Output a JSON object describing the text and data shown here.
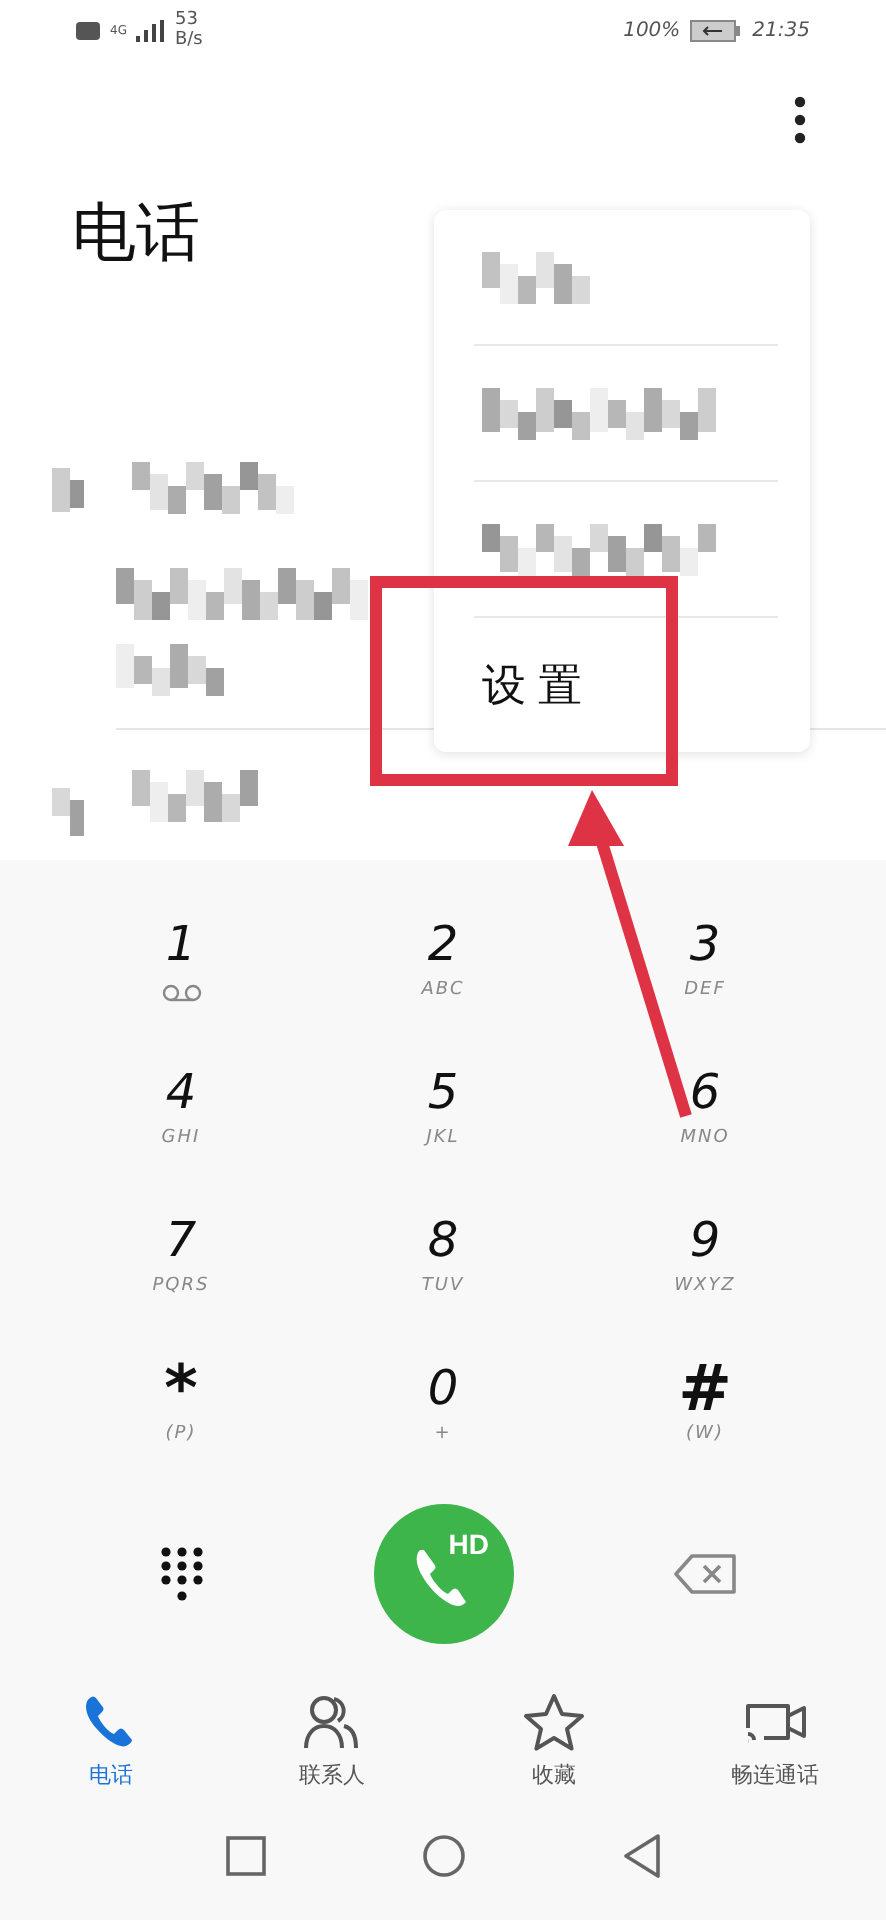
{
  "status_bar": {
    "network": "4G",
    "speed": "53",
    "speed_unit": "B/s",
    "battery": "100%",
    "time": "21:35"
  },
  "title": "电话",
  "menu": [
    {
      "kind": "blurred"
    },
    {
      "kind": "blurred"
    },
    {
      "kind": "blurred"
    },
    {
      "kind": "text",
      "label": "设置"
    }
  ],
  "keypad": [
    {
      "digit": "1",
      "kind": "voicemail"
    },
    {
      "digit": "2",
      "letters": "ABC"
    },
    {
      "digit": "3",
      "letters": "DEF"
    },
    {
      "digit": "4",
      "letters": "GHI"
    },
    {
      "digit": "5",
      "letters": "JKL"
    },
    {
      "digit": "6",
      "letters": "MNO"
    },
    {
      "digit": "7",
      "letters": "PQRS"
    },
    {
      "digit": "8",
      "letters": "TUV"
    },
    {
      "digit": "9",
      "letters": "WXYZ"
    },
    {
      "digit": "*",
      "letters": "(P)"
    },
    {
      "digit": "0",
      "letters": "+"
    },
    {
      "digit": "#",
      "letters": "(W)"
    }
  ],
  "call_button": {
    "badge": "HD"
  },
  "tabs": [
    {
      "label": "电话",
      "kind": "phone",
      "selected": true
    },
    {
      "label": "联系人",
      "kind": "contacts",
      "selected": false
    },
    {
      "label": "收藏",
      "kind": "star",
      "selected": false
    },
    {
      "label": "畅连通话",
      "kind": "video",
      "selected": false
    }
  ]
}
